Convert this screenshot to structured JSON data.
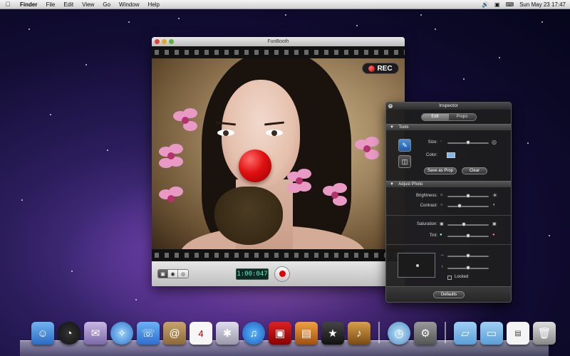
{
  "menubar": {
    "apple": "",
    "items": [
      "Finder",
      "File",
      "Edit",
      "View",
      "Go",
      "Window",
      "Help"
    ],
    "clock": "Sun May 23  17:47",
    "icons": [
      "volume-icon",
      "display-icon",
      "keyboard-icon"
    ]
  },
  "funbooth": {
    "title": "FunBooth",
    "rec_label": "REC",
    "timer": "1:00:047",
    "modes": [
      "video-mode-icon",
      "camera-mode-icon",
      "eye-mode-icon"
    ]
  },
  "inspector": {
    "title": "Inspector",
    "tabs": [
      "Edit",
      "Props"
    ],
    "active_tab": "Edit",
    "tools_section": "Tools",
    "size_label": "Size:",
    "color_label": "Color:",
    "color_value": "#7fb6ee",
    "save_as_prop": "Save as Prop",
    "clear": "Clear",
    "adjust_section": "Adjust Photo",
    "brightness_label": "Brightness:",
    "contrast_label": "Contrast:",
    "saturation_label": "Saturation:",
    "tint_label": "Tint:",
    "locked_label": "Locked",
    "defaults": "Defaults"
  }
}
